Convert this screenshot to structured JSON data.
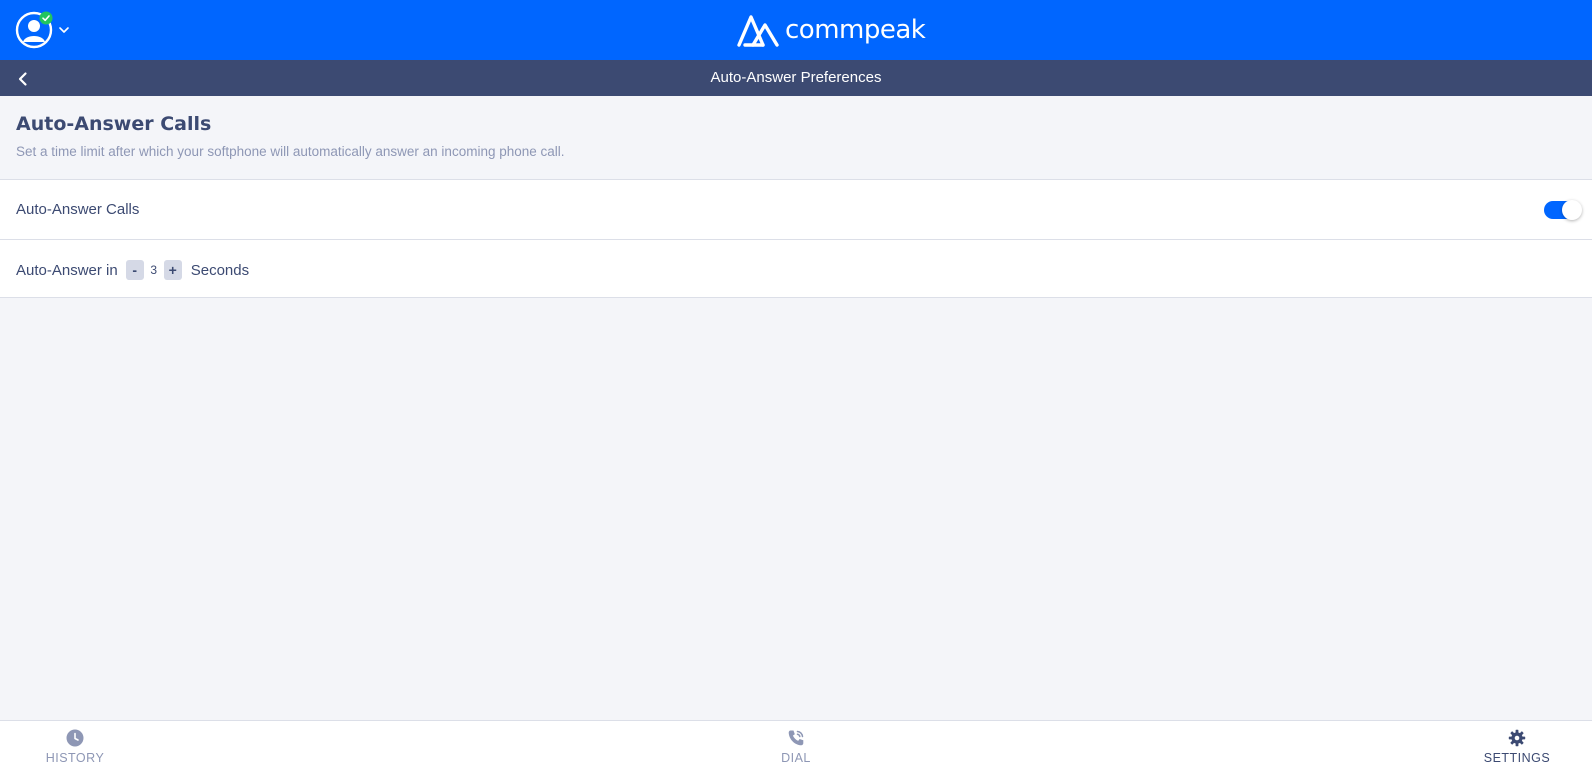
{
  "header": {
    "brand": "commpeak",
    "avatar_icon": "user-avatar-icon",
    "status_icon": "online-check-icon",
    "status_color": "#22c55e",
    "accent_color": "#0066ff"
  },
  "subheader": {
    "title": "Auto-Answer Preferences",
    "back_icon": "chevron-left-icon",
    "background_color": "#3c4a72"
  },
  "section": {
    "title": "Auto-Answer Calls",
    "description": "Set a time limit after which your softphone will automatically answer an incoming phone call."
  },
  "settings": {
    "auto_answer": {
      "label": "Auto-Answer Calls",
      "enabled": true
    },
    "delay": {
      "prefix": "Auto-Answer in",
      "decrement_label": "-",
      "value": "3",
      "increment_label": "+",
      "suffix": "Seconds"
    }
  },
  "bottom_nav": {
    "active": "settings",
    "items": [
      {
        "id": "history",
        "label": "HISTORY",
        "icon": "clock-icon"
      },
      {
        "id": "dial",
        "label": "DIAL",
        "icon": "phone-icon"
      },
      {
        "id": "settings",
        "label": "SETTINGS",
        "icon": "gear-icon"
      }
    ]
  }
}
